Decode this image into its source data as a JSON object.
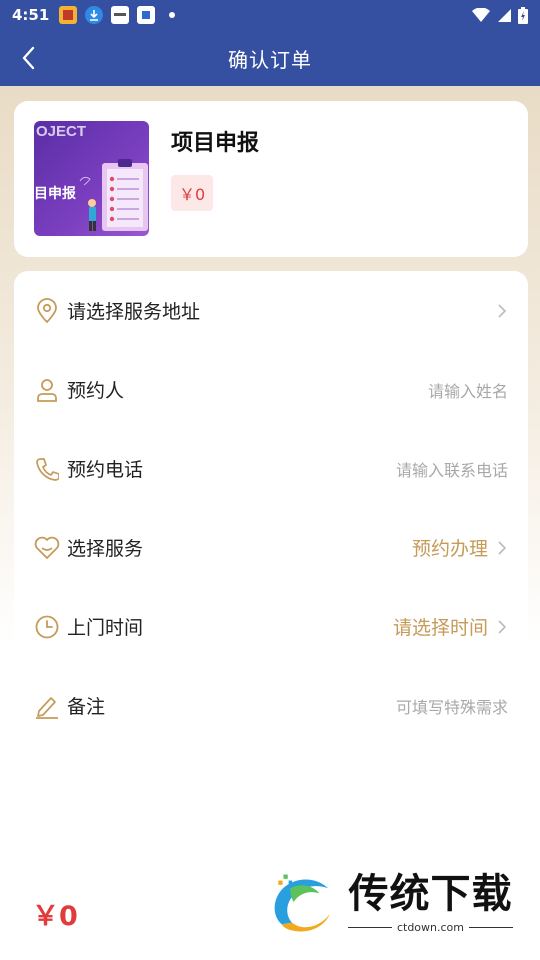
{
  "status_bar": {
    "time": "4:51"
  },
  "nav": {
    "title": "确认订单"
  },
  "product": {
    "thumb_top_text": "OJECT",
    "thumb_mid_text": "目申报",
    "name": "项目申报",
    "price": "￥0"
  },
  "form": {
    "address": {
      "label": "请选择服务地址",
      "icon": "location-icon"
    },
    "contact": {
      "label": "预约人",
      "placeholder": "请输入姓名",
      "icon": "person-icon"
    },
    "phone": {
      "label": "预约电话",
      "placeholder": "请输入联系电话",
      "icon": "phone-icon"
    },
    "service": {
      "label": "选择服务",
      "value": "预约办理",
      "icon": "heart-icon"
    },
    "time": {
      "label": "上门时间",
      "value": "请选择时间",
      "icon": "clock-icon"
    },
    "note": {
      "label": "备注",
      "placeholder": "可填写特殊需求",
      "icon": "edit-icon"
    }
  },
  "footer": {
    "total_price": "￥0"
  },
  "watermark": {
    "title": "传统下载",
    "url": "ctdown.com"
  },
  "colors": {
    "brand_blue": "#3550a0",
    "gold": "#c69a58",
    "price_red": "#e03c3c"
  }
}
